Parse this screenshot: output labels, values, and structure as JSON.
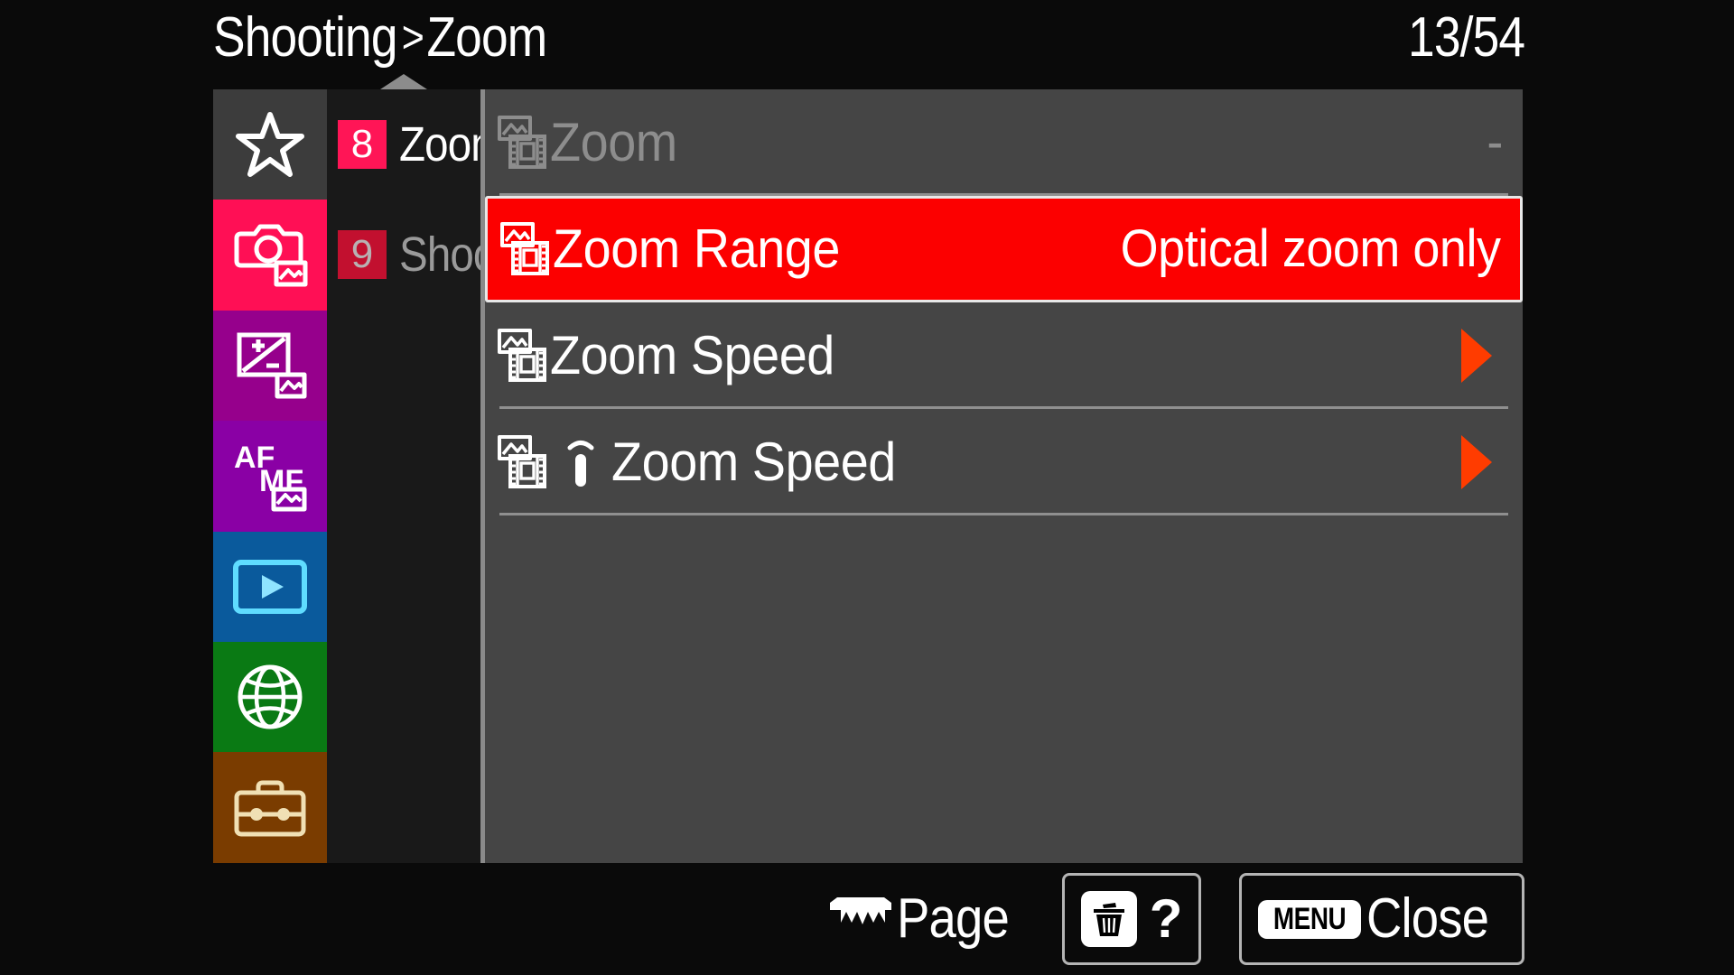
{
  "header": {
    "breadcrumb_root": "Shooting",
    "breadcrumb_separator": ">",
    "breadcrumb_current": "Zoom",
    "page_counter": "13/54"
  },
  "sidebar": {
    "icons": [
      {
        "name": "my-menu-star-icon",
        "label": "My Menu",
        "color": "#3c3c3c",
        "glyph": "star"
      },
      {
        "name": "shooting-camera-icon",
        "label": "Shooting",
        "color": "#ff0f55",
        "glyph": "camera"
      },
      {
        "name": "exposure-color-icon",
        "label": "Exposure/Color",
        "color": "#96008c",
        "glyph": "exposure"
      },
      {
        "name": "focus-afmf-icon",
        "label": "Focus",
        "color": "#8a00a5",
        "glyph": "afmf"
      },
      {
        "name": "playback-icon",
        "label": "Playback",
        "color": "#0a5a9c",
        "glyph": "play"
      },
      {
        "name": "network-globe-icon",
        "label": "Network",
        "color": "#0a7a14",
        "glyph": "globe"
      },
      {
        "name": "setup-toolbox-icon",
        "label": "Setup",
        "color": "#7a3c00",
        "glyph": "toolbox"
      }
    ],
    "pages": [
      {
        "number": "8",
        "label": "Zoom",
        "active": true
      },
      {
        "number": "9",
        "label": "Shooting",
        "active": false
      }
    ]
  },
  "menu": {
    "rows": [
      {
        "icon": "still-movie-icon",
        "label": "Zoom",
        "value": "-",
        "enabled": false,
        "selected": false,
        "has_arrow": false,
        "has_remote_icon": false
      },
      {
        "icon": "still-movie-icon",
        "label": "Zoom Range",
        "value": "Optical zoom only",
        "enabled": true,
        "selected": true,
        "has_arrow": false,
        "has_remote_icon": false
      },
      {
        "icon": "still-movie-icon",
        "label": "Zoom Speed",
        "value": "",
        "enabled": true,
        "selected": false,
        "has_arrow": true,
        "has_remote_icon": false
      },
      {
        "icon": "still-movie-icon",
        "label": "Zoom Speed",
        "value": "",
        "enabled": true,
        "selected": false,
        "has_arrow": true,
        "has_remote_icon": true,
        "remote_icon": "remote-control-icon"
      }
    ]
  },
  "footer": {
    "page_icon": "control-wheel-icon",
    "page_label": "Page",
    "help_trash_icon": "trash-icon",
    "help_label": "?",
    "menu_badge_label": "MENU",
    "close_label": "Close"
  },
  "colors": {
    "selection_red": "#fc0000",
    "arrow_orange": "#ff3c00",
    "panel_gray": "#454545",
    "page_column": "#191919",
    "background": "#0a0a0a",
    "badge_active": "#ff1556",
    "badge_inactive": "#c2102f"
  }
}
